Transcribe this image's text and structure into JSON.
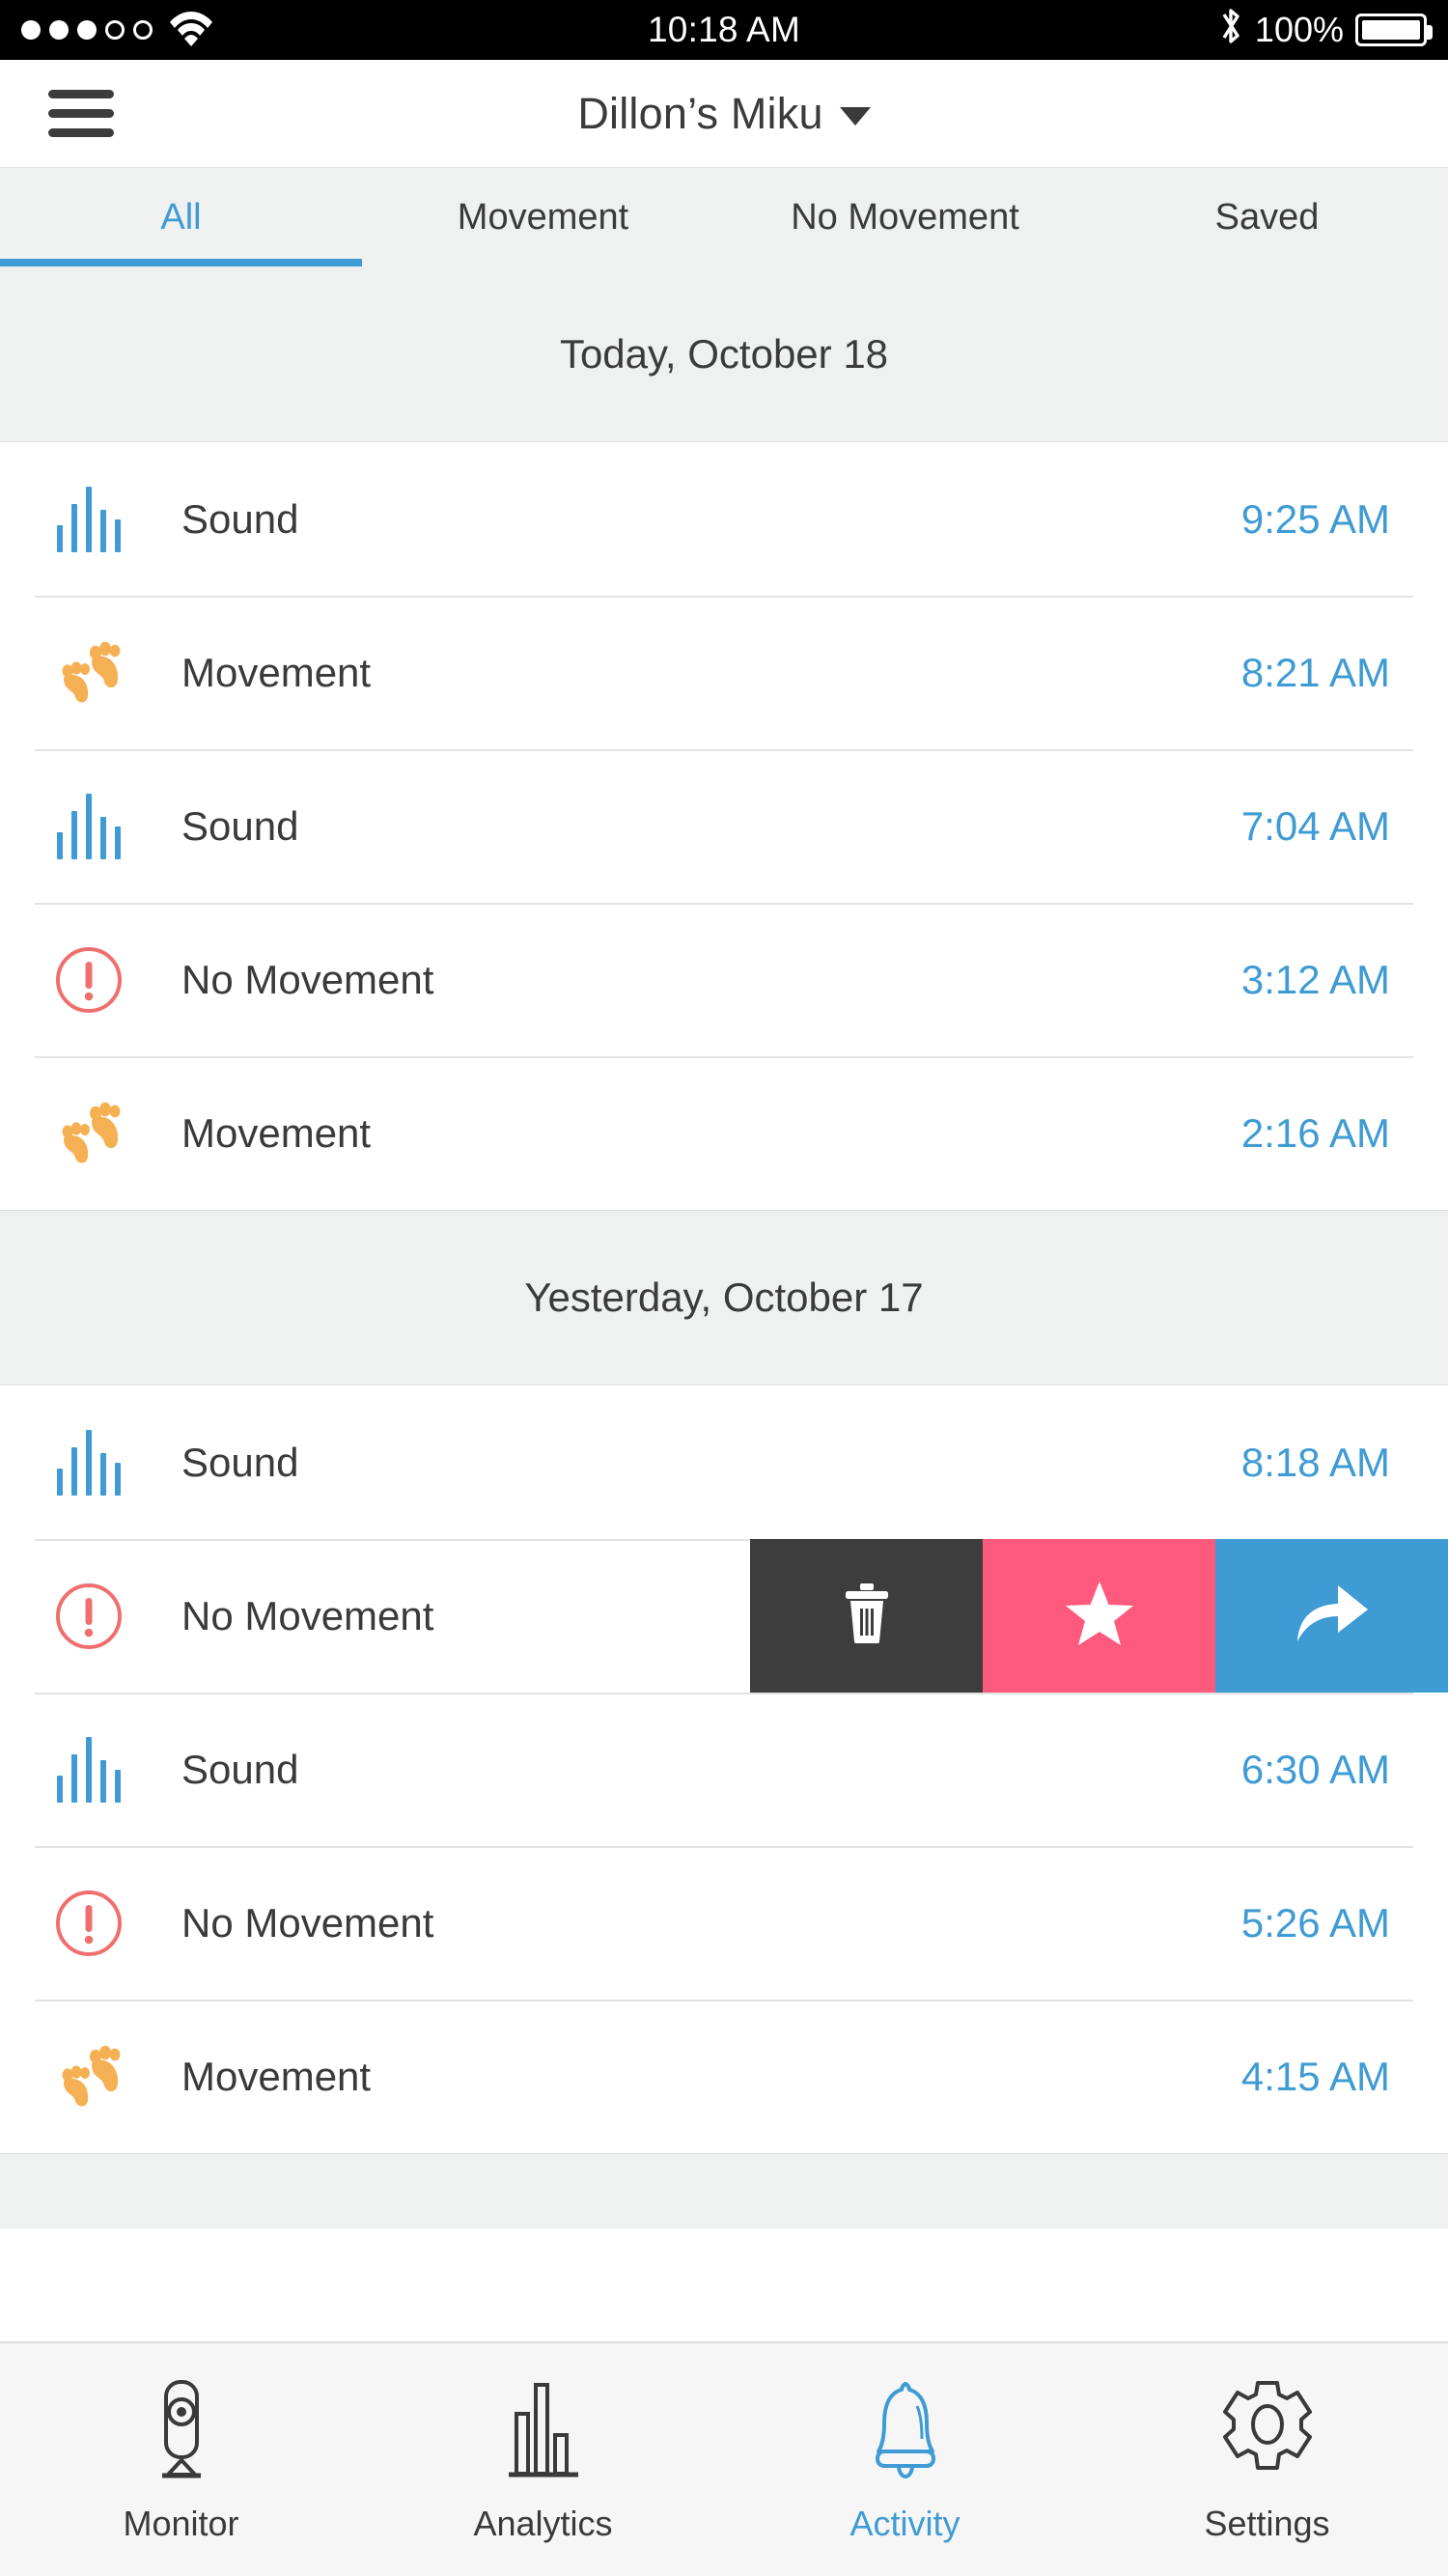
{
  "status_bar": {
    "signal_dots_filled": 3,
    "signal_dots_total": 5,
    "wifi_icon": "wifi-icon",
    "time": "10:18 AM",
    "bluetooth_icon": "bluetooth-icon",
    "battery_percent": "100%",
    "battery_icon": "battery-full-icon"
  },
  "header": {
    "menu_icon": "hamburger-menu-icon",
    "title": "Dillon’s Miku",
    "dropdown_icon": "chevron-down-icon"
  },
  "tabs": {
    "active_index": 0,
    "items": [
      {
        "label": "All"
      },
      {
        "label": "Movement"
      },
      {
        "label": "No Movement"
      },
      {
        "label": "Saved"
      }
    ]
  },
  "sections": [
    {
      "header": "Today, October 18",
      "rows": [
        {
          "icon": "sound-wave-icon",
          "type": "sound",
          "label": "Sound",
          "time": "9:25 AM",
          "swiped": false
        },
        {
          "icon": "baby-footprints-icon",
          "type": "movement",
          "label": "Movement",
          "time": "8:21 AM",
          "swiped": false
        },
        {
          "icon": "sound-wave-icon",
          "type": "sound",
          "label": "Sound",
          "time": "7:04 AM",
          "swiped": false
        },
        {
          "icon": "alert-circle-icon",
          "type": "no-movement",
          "label": "No Movement",
          "time": "3:12 AM",
          "swiped": false
        },
        {
          "icon": "baby-footprints-icon",
          "type": "movement",
          "label": "Movement",
          "time": "2:16 AM",
          "swiped": false
        }
      ]
    },
    {
      "header": "Yesterday, October 17",
      "rows": [
        {
          "icon": "sound-wave-icon",
          "type": "sound",
          "label": "Sound",
          "time": "8:18 AM",
          "swiped": false
        },
        {
          "icon": "alert-circle-icon",
          "type": "no-movement",
          "label": "No Movement",
          "time": "",
          "swiped": true
        },
        {
          "icon": "sound-wave-icon",
          "type": "sound",
          "label": "Sound",
          "time": "6:30 AM",
          "swiped": false
        },
        {
          "icon": "alert-circle-icon",
          "type": "no-movement",
          "label": "No Movement",
          "time": "5:26 AM",
          "swiped": false
        },
        {
          "icon": "baby-footprints-icon",
          "type": "movement",
          "label": "Movement",
          "time": "4:15 AM",
          "swiped": false
        }
      ]
    }
  ],
  "swipe_actions": [
    {
      "name": "delete",
      "icon": "trash-icon",
      "color": "#3d3d3d"
    },
    {
      "name": "save",
      "icon": "star-icon",
      "color": "#fd5a7d"
    },
    {
      "name": "share",
      "icon": "share-arrow-icon",
      "color": "#3f9bd4"
    }
  ],
  "tabbar": {
    "active_index": 2,
    "items": [
      {
        "label": "Monitor",
        "icon": "camera-monitor-icon"
      },
      {
        "label": "Analytics",
        "icon": "bar-chart-icon"
      },
      {
        "label": "Activity",
        "icon": "bell-icon"
      },
      {
        "label": "Settings",
        "icon": "gear-icon"
      }
    ]
  },
  "colors": {
    "accent_blue": "#3f9bd4",
    "alert_red": "#ef6f6f",
    "movement_orange": "#f6b054",
    "action_pink": "#fd5a7d",
    "action_dark": "#3d3d3d",
    "section_gray": "#eff0f0"
  }
}
